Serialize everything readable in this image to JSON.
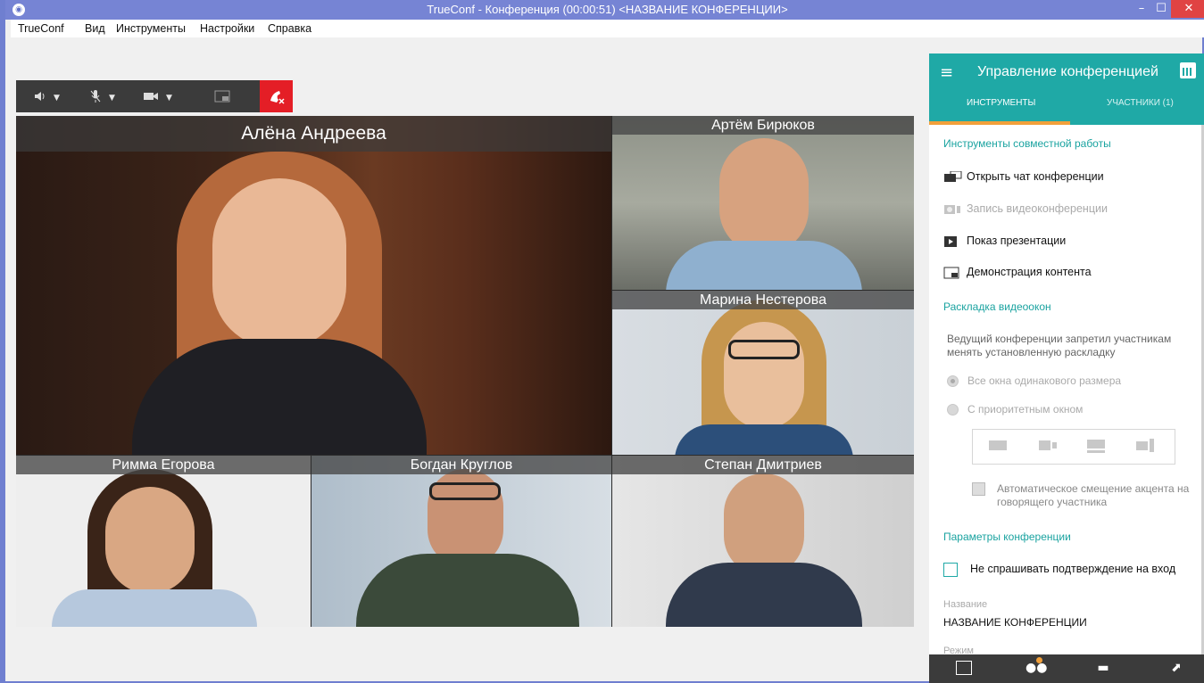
{
  "window": {
    "title": "TrueConf - Конференция (00:00:51) <НАЗВАНИЕ КОНФЕРЕНЦИИ>",
    "min": "–",
    "max": "☐",
    "close": "✕",
    "icon": "trueconf-icon"
  },
  "menu": [
    "TrueConf",
    "Вид",
    "Инструменты",
    "Настройки",
    "Справка"
  ],
  "toolbar": {
    "speaker": "speaker-icon",
    "mic": "mic-icon",
    "camera": "camera-icon",
    "screen": "screen-share-icon",
    "hangup": "hang-up-icon"
  },
  "participants": [
    {
      "name": "Алёна Андреева"
    },
    {
      "name": "Артём Бирюков"
    },
    {
      "name": "Марина Нестерова"
    },
    {
      "name": "Римма Егорова"
    },
    {
      "name": "Богдан Круглов"
    },
    {
      "name": "Степан Дмитриев"
    }
  ],
  "panel": {
    "title": "Управление конференцией",
    "tabs": [
      "ИНСТРУМЕНТЫ",
      "УЧАСТНИКИ (1)"
    ],
    "collab_title": "Инструменты совместной работы",
    "tools": [
      "Открыть чат конференции",
      "Запись видеоконференции",
      "Показ презентации",
      "Демонстрация контента"
    ],
    "layout_title": "Раскладка видеоокон",
    "layout_note": "Ведущий конференции запретил участникам менять установленную раскладку",
    "radio_equal": "Все окна одинакового размера",
    "radio_priority": "С приоритетным окном",
    "auto_focus": "Автоматическое смещение акцента на говорящего участника",
    "params_title": "Параметры конференции",
    "no_confirm": "Не спрашивать подтверждение на вход",
    "name_label": "Название",
    "name_value": "НАЗВАНИЕ КОНФЕРЕНЦИИ",
    "mode_label": "Режим"
  },
  "colors": {
    "accent": "#1fa9a6",
    "title_bar": "#7684d4",
    "hangup": "#e41e26",
    "tab_underline": "#f2a03a"
  }
}
